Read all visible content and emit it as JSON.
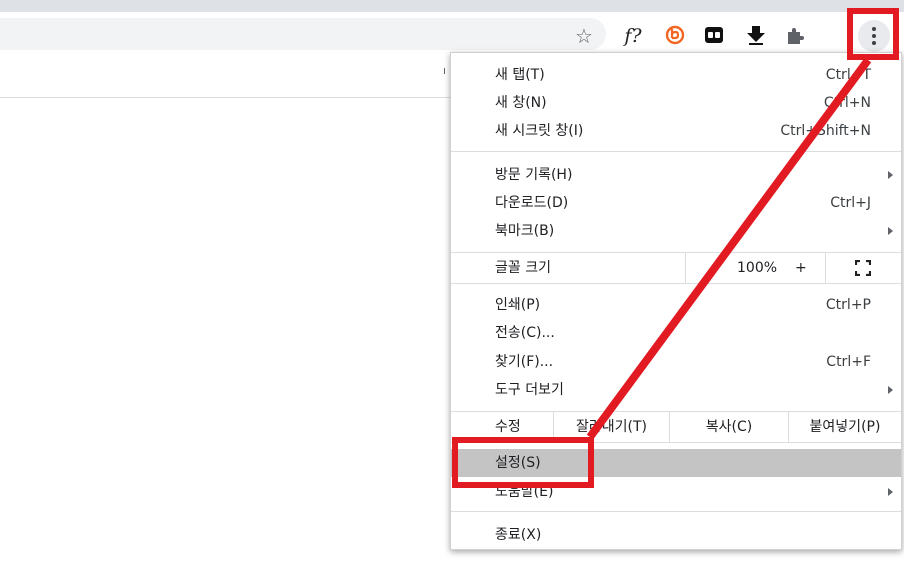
{
  "toolbar": {
    "icons": [
      "star-icon",
      "formula-extension-icon",
      "orange-b-extension-icon",
      "tweetdeck-extension-icon",
      "download-extension-icon",
      "puzzle-extensions-icon",
      "kebab-menu-icon"
    ],
    "ext_f_text": "f?",
    "bookmark_fragment": "ı"
  },
  "menu": {
    "group1": [
      {
        "label": "새 탭(T)",
        "shortcut": "Ctrl+T"
      },
      {
        "label": "새 창(N)",
        "shortcut": "Ctrl+N"
      },
      {
        "label": "새 시크릿 창(I)",
        "shortcut": "Ctrl+Shift+N"
      }
    ],
    "group2": [
      {
        "label": "방문 기록(H)",
        "shortcut": ""
      },
      {
        "label": "다운로드(D)",
        "shortcut": "Ctrl+J"
      },
      {
        "label": "북마크(B)",
        "shortcut": ""
      }
    ],
    "zoom": {
      "label": "글꼴 크기",
      "percent": "100%",
      "plus": "+"
    },
    "group3": [
      {
        "label": "인쇄(P)",
        "shortcut": "Ctrl+P"
      },
      {
        "label": "전송(C)...",
        "shortcut": ""
      },
      {
        "label": "찾기(F)...",
        "shortcut": "Ctrl+F"
      },
      {
        "label": "도구 더보기",
        "shortcut": ""
      }
    ],
    "edit": {
      "label": "수정",
      "cut": "잘라내기(T)",
      "copy": "복사(C)",
      "paste": "붙여넣기(P)"
    },
    "settings": "설정(S)",
    "help": "도움말(E)",
    "exit": "종료(X)"
  },
  "colors": {
    "annotation": "#e21b23",
    "highlight": "#c4c4c4"
  }
}
